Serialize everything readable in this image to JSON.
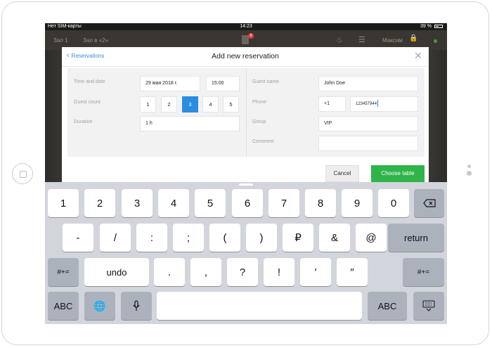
{
  "status_bar": {
    "carrier": "Нет SIM-карты",
    "wifi_icon": "wifi-icon",
    "time": "14:23",
    "battery": "39 %"
  },
  "app_bar": {
    "hall1": "Зал 1",
    "hall2": "Зал в «2»",
    "badge": "8",
    "user": "Максим"
  },
  "modal": {
    "back_label": "Reservations",
    "title": "Add new reservation",
    "left": {
      "time_date_label": "Time and date",
      "date_value": "29 мая 2018 г.",
      "time_value": "15:00",
      "guest_count_label": "Guest count",
      "guest_counts": [
        "1",
        "2",
        "3",
        "4",
        "5"
      ],
      "selected_guest_count": "3",
      "duration_label": "Duration",
      "duration_value": "1 h"
    },
    "right": {
      "guest_name_label": "Guest name",
      "guest_name_value": "John Doe",
      "phone_label": "Phone",
      "phone_code": "+1",
      "phone_number": "123457944",
      "group_label": "Group",
      "group_value": "VIP",
      "comment_label": "Comment",
      "comment_value": ""
    },
    "cancel_label": "Cancel",
    "choose_label": "Choose table"
  },
  "keyboard": {
    "row1": [
      "1",
      "2",
      "3",
      "4",
      "5",
      "6",
      "7",
      "8",
      "9",
      "0"
    ],
    "row2": [
      "-",
      "/",
      ":",
      ";",
      "(",
      ")",
      "₽",
      "&",
      "@"
    ],
    "return_label": "return",
    "row3_left": "#+=",
    "undo_label": "undo",
    "row3": [
      ".",
      ",",
      "?",
      "!",
      "′",
      "″"
    ],
    "row3_right": "#+=",
    "abc_left": "ABC",
    "abc_right": "ABC",
    "accent_color": "#2a8de0",
    "confirm_color": "#2fb449"
  }
}
